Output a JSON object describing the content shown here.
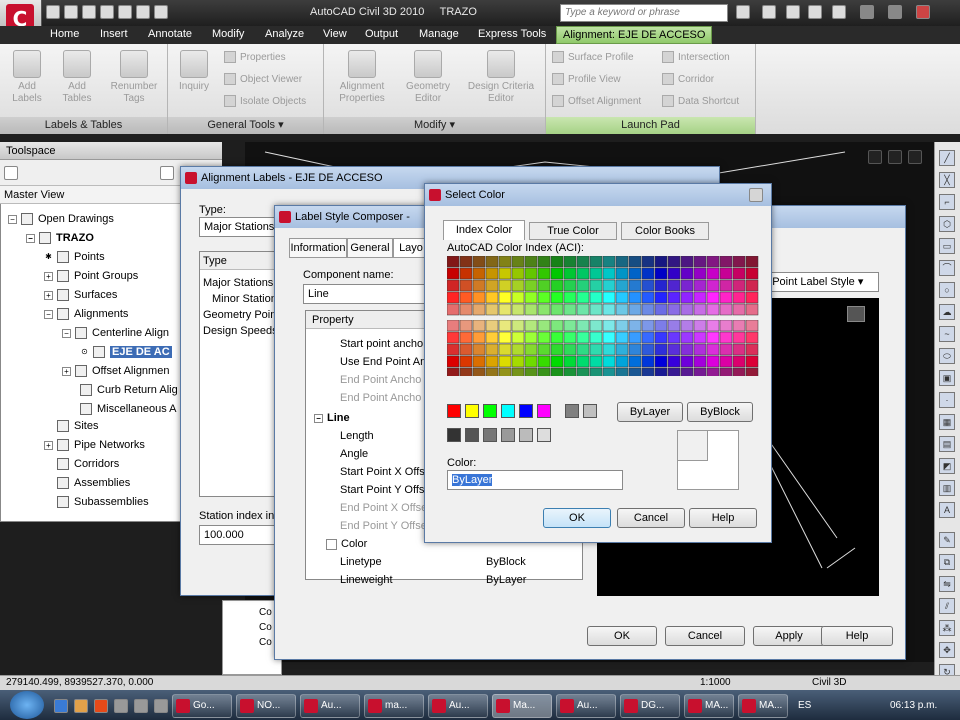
{
  "app": {
    "title": "AutoCAD Civil 3D 2010",
    "drawing": "TRAZO",
    "search_placeholder": "Type a keyword or phrase"
  },
  "tabs": [
    "Home",
    "Insert",
    "Annotate",
    "Modify",
    "Analyze",
    "View",
    "Output",
    "Manage",
    "Express Tools",
    "Alignment: EJE DE ACCESO"
  ],
  "ribbon": {
    "panels": {
      "labels_tables": {
        "title": "Labels & Tables",
        "add_labels": "Add Labels",
        "add_tables": "Add Tables",
        "renumber_tags": "Renumber Tags"
      },
      "general_tools": {
        "title": "General Tools",
        "inquiry": "Inquiry",
        "properties": "Properties",
        "object_viewer": "Object Viewer",
        "isolate_objects": "Isolate Objects"
      },
      "modify": {
        "title": "Modify",
        "alignment_properties": "Alignment Properties",
        "geometry_editor": "Geometry Editor",
        "design_criteria_editor": "Design Criteria Editor"
      },
      "launch_pad": {
        "title": "Launch Pad",
        "surface_profile": "Surface Profile",
        "profile_view": "Profile View",
        "offset_alignment": "Offset Alignment",
        "intersection": "Intersection",
        "corridor": "Corridor",
        "data_shortcut": "Data Shortcut"
      }
    }
  },
  "toolspace": {
    "title": "Toolspace",
    "view": "Master View",
    "tree": {
      "open_drawings": "Open Drawings",
      "trazo": "TRAZO",
      "points": "Points",
      "point_groups": "Point Groups",
      "surfaces": "Surfaces",
      "alignments": "Alignments",
      "centerline": "Centerline Align",
      "eje": "EJE DE AC",
      "offset": "Offset Alignmen",
      "curb_return": "Curb Return Alig",
      "misc": "Miscellaneous A",
      "sites": "Sites",
      "pipe_networks": "Pipe Networks",
      "corridors": "Corridors",
      "assemblies": "Assemblies",
      "subassemblies": "Subassemblies"
    }
  },
  "alignment_labels": {
    "title": "Alignment Labels - EJE DE ACCESO",
    "type_label": "Type:",
    "type_value": "Major Stations",
    "col_type": "Type",
    "rows": [
      "Major Stations",
      "Minor Stations",
      "Geometry Points",
      "Design Speeds"
    ],
    "station_increment_label": "Station index incr",
    "station_increment_value": "100.000"
  },
  "composer": {
    "title": "Label Style Composer - ",
    "tabs": [
      "Information",
      "General",
      "Layo"
    ],
    "component_label": "Component name:",
    "component_value": "Line",
    "property_header": "Property",
    "rows": [
      {
        "name": "Start point ancho",
        "value": ""
      },
      {
        "name": "Use End Point An",
        "value": ""
      },
      {
        "name": "End Point Ancho",
        "value": ""
      },
      {
        "name": "End Point Ancho",
        "value": ""
      },
      {
        "name": "Line",
        "value": ""
      },
      {
        "name": "Length",
        "value": ""
      },
      {
        "name": "Angle",
        "value": ""
      },
      {
        "name": "Start Point X Offs",
        "value": ""
      },
      {
        "name": "Start Point Y Offs",
        "value": ""
      },
      {
        "name": "End Point X Offse",
        "value": ""
      },
      {
        "name": "End Point Y Offse",
        "value": ""
      },
      {
        "name": "Color",
        "value": ""
      },
      {
        "name": "Linetype",
        "value": "ByBlock"
      },
      {
        "name": "Lineweight",
        "value": "ByLayer"
      }
    ],
    "preview_style": "ry Point Label Style",
    "ok": "OK",
    "cancel": "Cancel",
    "apply": "Apply",
    "help": "Help"
  },
  "select_color": {
    "title": "Select Color",
    "tabs": [
      "Index Color",
      "True Color",
      "Color Books"
    ],
    "aci_label": "AutoCAD Color Index (ACI):",
    "bylayer": "ByLayer",
    "byblock": "ByBlock",
    "color_label": "Color:",
    "color_value": "ByLayer",
    "ok": "OK",
    "cancel": "Cancel",
    "help": "Help"
  },
  "status": {
    "coords": "279140.499, 8939527.370, 0.000",
    "scale": "1:1000",
    "workspace": "Civil 3D"
  },
  "taskbar": {
    "buttons": [
      "Go...",
      "NO...",
      "Au...",
      "ma...",
      "Au...",
      "Ma...",
      "Au...",
      "DG...",
      "MA...",
      "MA..."
    ],
    "lang": "ES",
    "clock": "06:13 p.m."
  },
  "cmd_lines": [
    "Co",
    "Co",
    "Co"
  ],
  "colors": {
    "accent": "#c8102e",
    "ctx_tab": "#9fd47a"
  }
}
